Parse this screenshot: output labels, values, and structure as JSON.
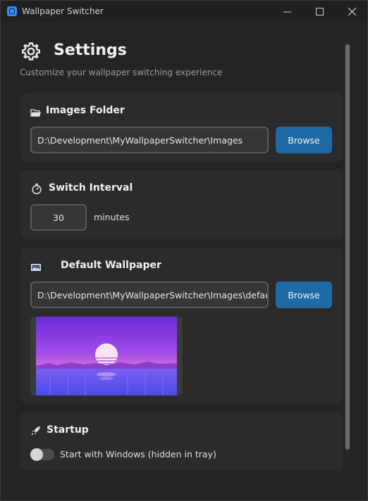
{
  "window": {
    "title": "Wallpaper Switcher"
  },
  "header": {
    "title": "Settings",
    "subtitle": "Customize your wallpaper switching experience"
  },
  "sections": {
    "images_folder": {
      "title": "Images Folder",
      "path": "D:\\Development\\MyWallpaperSwitcher\\Images",
      "browse_label": "Browse"
    },
    "switch_interval": {
      "title": "Switch Interval",
      "value": "30",
      "unit": "minutes"
    },
    "default_wallpaper": {
      "title": "Default Wallpaper",
      "path": "D:\\Development\\MyWallpaperSwitcher\\Images\\default.p",
      "browse_label": "Browse"
    },
    "startup": {
      "title": "Startup",
      "toggle_label": "Start with Windows (hidden in tray)",
      "toggle_on": false
    }
  },
  "colors": {
    "accent": "#1f6aa5",
    "background": "#242424",
    "card": "#2b2b2b"
  },
  "icons": {
    "app": "app-icon",
    "settings": "gear-icon",
    "folder": "folder-icon",
    "interval": "stopwatch-icon",
    "wallpaper": "picture-icon",
    "startup": "rocket-icon"
  }
}
